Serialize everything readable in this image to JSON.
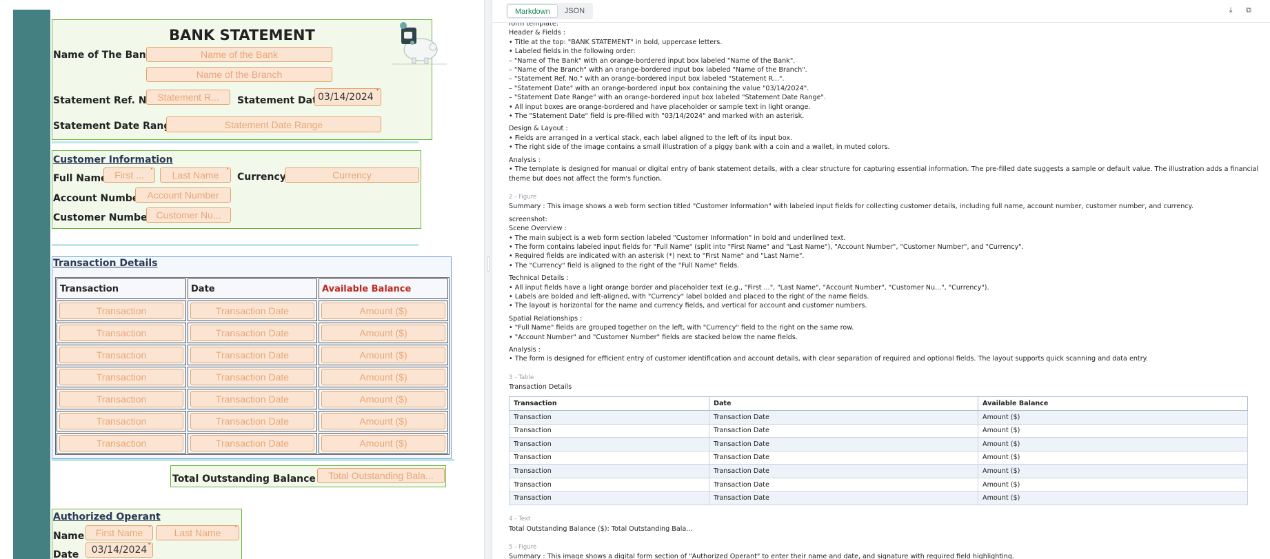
{
  "form": {
    "title": "BANK STATEMENT",
    "bank_name_label": "Name of The Bank",
    "bank_name_ph": "Name of the Bank",
    "branch_ph": "Name of the Branch",
    "ref_label": "Statement Ref. No.",
    "ref_ph": "Statement R...",
    "date_label": "Statement Date",
    "date_value": "03/14/2024",
    "range_label": "Statement Date Range",
    "range_ph": "Statement Date Range",
    "customer_heading": "Customer Information",
    "full_name_label": "Full Name",
    "first_ph": "First ...",
    "last_ph": "Last Name",
    "currency_label": "Currency",
    "currency_ph": "Currency",
    "account_label": "Account Number",
    "account_ph": "Account Number",
    "custnum_label": "Customer Number",
    "custnum_ph": "Customer Nu...",
    "transactions_heading": "Transaction Details",
    "table_headers": [
      "Transaction",
      "Date",
      "Available Balance"
    ],
    "row_placeholders": [
      "Transaction",
      "Transaction Date",
      "Amount ($)"
    ],
    "total_label": "Total Outstanding Balance ($)",
    "total_ph": "Total Outstanding Bala...",
    "operant_heading": "Authorized Operant",
    "op_name_label": "Name",
    "op_first_ph": "First Name",
    "op_last_ph": "Last Name",
    "op_date_label": "Date",
    "op_date_value": "03/14/2024"
  },
  "viewer": {
    "tabs": [
      "Markdown",
      "JSON"
    ],
    "active_tab": "Markdown",
    "icons": [
      "download-icon",
      "copy-icon"
    ],
    "lines_1": [
      "form template:",
      "Header & Fields :",
      "• Title at the top: \"BANK STATEMENT\" in bold, uppercase letters.",
      "• Labeled fields in the following order:",
      "– \"Name of The Bank\" with an orange-bordered input box labeled \"Name of the Bank\".",
      "– \"Name of the Branch\" with an orange-bordered input box labeled \"Name of the Branch\".",
      "– \"Statement Ref. No.\" with an orange-bordered input box labeled \"Statement R...\".",
      "– \"Statement Date\" with an orange-bordered input box containing the value \"03/14/2024\".",
      "– \"Statement Date Range\" with an orange-bordered input box labeled \"Statement Date Range\".",
      "• All input boxes are orange-bordered and have placeholder or sample text in light orange.",
      "• The \"Statement Date\" field is pre-filled with \"03/14/2024\" and marked with an asterisk."
    ],
    "design_heading": "Design & Layout :",
    "design_lines": [
      "• Fields are arranged in a vertical stack, each label aligned to the left of its input box.",
      "• The right side of the image contains a small illustration of a piggy bank with a coin and a wallet, in muted colors."
    ],
    "analysis1_heading": "Analysis :",
    "analysis1_text": "• The template is designed for manual or digital entry of bank statement details, with a clear structure for capturing essential information. The pre-filled date suggests a sample or default value. The illustration adds a financial theme but does not affect the form's function.",
    "fig2_tag": "2 - Figure",
    "fig2_summary": "Summary : This image shows a web form section titled \"Customer Information\" with labeled input fields for collecting customer details, including full name, account number, customer number, and currency.",
    "screenshot_label": "screenshot:",
    "scene_heading": "Scene Overview :",
    "scene_lines": [
      "• The main subject is a web form section labeled \"Customer Information\" in bold and underlined text.",
      "• The form contains labeled input fields for \"Full Name\" (split into \"First Name\" and \"Last Name\"), \"Account Number\", \"Customer Number\", and \"Currency\".",
      "• Required fields are indicated with an asterisk (*) next to \"First Name\" and \"Last Name\".",
      "• The \"Currency\" field is aligned to the right of the \"Full Name\" fields."
    ],
    "tech_heading": "Technical Details :",
    "tech_lines": [
      "• All input fields have a light orange border and placeholder text (e.g., \"First ...\", \"Last Name\", \"Account Number\", \"Customer Nu...\", \"Currency\").",
      "• Labels are bolded and left-aligned, with \"Currency\" label bolded and placed to the right of the name fields.",
      "• The layout is horizontal for the name and currency fields, and vertical for account and customer numbers."
    ],
    "spatial_heading": "Spatial Relationships :",
    "spatial_lines": [
      "• \"Full Name\" fields are grouped together on the left, with \"Currency\" field to the right on the same row.",
      "• \"Account Number\" and \"Customer Number\" fields are stacked below the name fields."
    ],
    "analysis2_heading": "Analysis :",
    "analysis2_text": "• The form is designed for efficient entry of customer identification and account details, with clear separation of required and optional fields. The layout supports quick scanning and data entry.",
    "table_tag": "3 - Table",
    "table_caption": "Transaction Details",
    "table_headers": [
      "Transaction",
      "Date",
      "Available Balance"
    ],
    "table_rows": [
      [
        "Transaction",
        "Transaction Date",
        "Amount ($)"
      ],
      [
        "Transaction",
        "Transaction Date",
        "Amount ($)"
      ],
      [
        "Transaction",
        "Transaction Date",
        "Amount ($)"
      ],
      [
        "Transaction",
        "Transaction Date",
        "Amount ($)"
      ],
      [
        "Transaction",
        "Transaction Date",
        "Amount ($)"
      ],
      [
        "Transaction",
        "Transaction Date",
        "Amount ($)"
      ],
      [
        "Transaction",
        "Transaction Date",
        "Amount ($)"
      ]
    ],
    "text_tag": "4 - Text",
    "text_line": "Total Outstanding Balance ($): Total Outstanding Bala...",
    "fig5_tag": "5 - Figure",
    "fig5_partial": "Summary : This image shows a digital form section of \"Authorized Operant\" to enter their name and date, and signature with required field highlighting."
  }
}
